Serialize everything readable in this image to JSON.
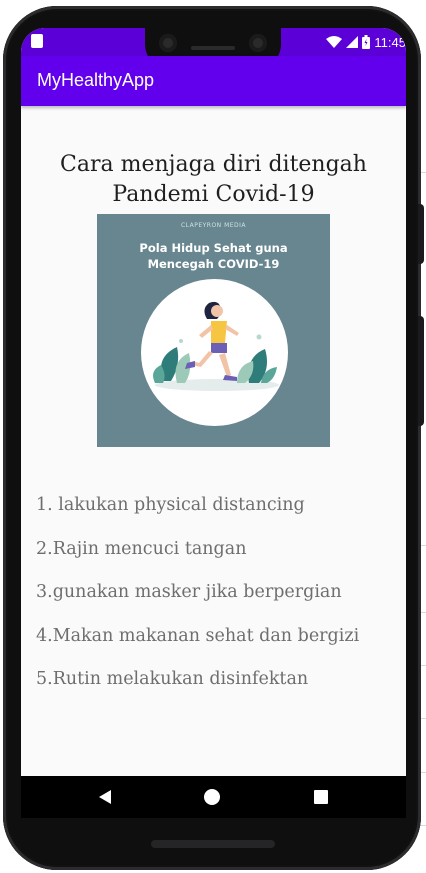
{
  "status_bar": {
    "time": "11:45"
  },
  "app_bar": {
    "title": "MyHealthyApp"
  },
  "content": {
    "heading_line1": "Cara menjaga diri ditengah",
    "heading_line2": "Pandemi Covid-19",
    "poster": {
      "brand": "CLAPEYRON MEDIA",
      "title_line1": "Pola Hidup Sehat guna",
      "title_line2": "Mencegah COVID-19"
    },
    "tips": [
      "1. lakukan physical distancing",
      "2.Rajin mencuci tangan",
      "3.gunakan masker jika berpergian",
      "4.Makan makanan sehat dan bergizi",
      "5.Rutin melakukan disinfektan"
    ]
  },
  "nav": {
    "back_icon": "back-triangle",
    "home_icon": "home-circle",
    "recent_icon": "recents-square"
  },
  "colors": {
    "status_bar": "#5b00d6",
    "app_bar": "#6200ee",
    "poster_bg": "#688690",
    "screen_bg": "#fafafa"
  }
}
